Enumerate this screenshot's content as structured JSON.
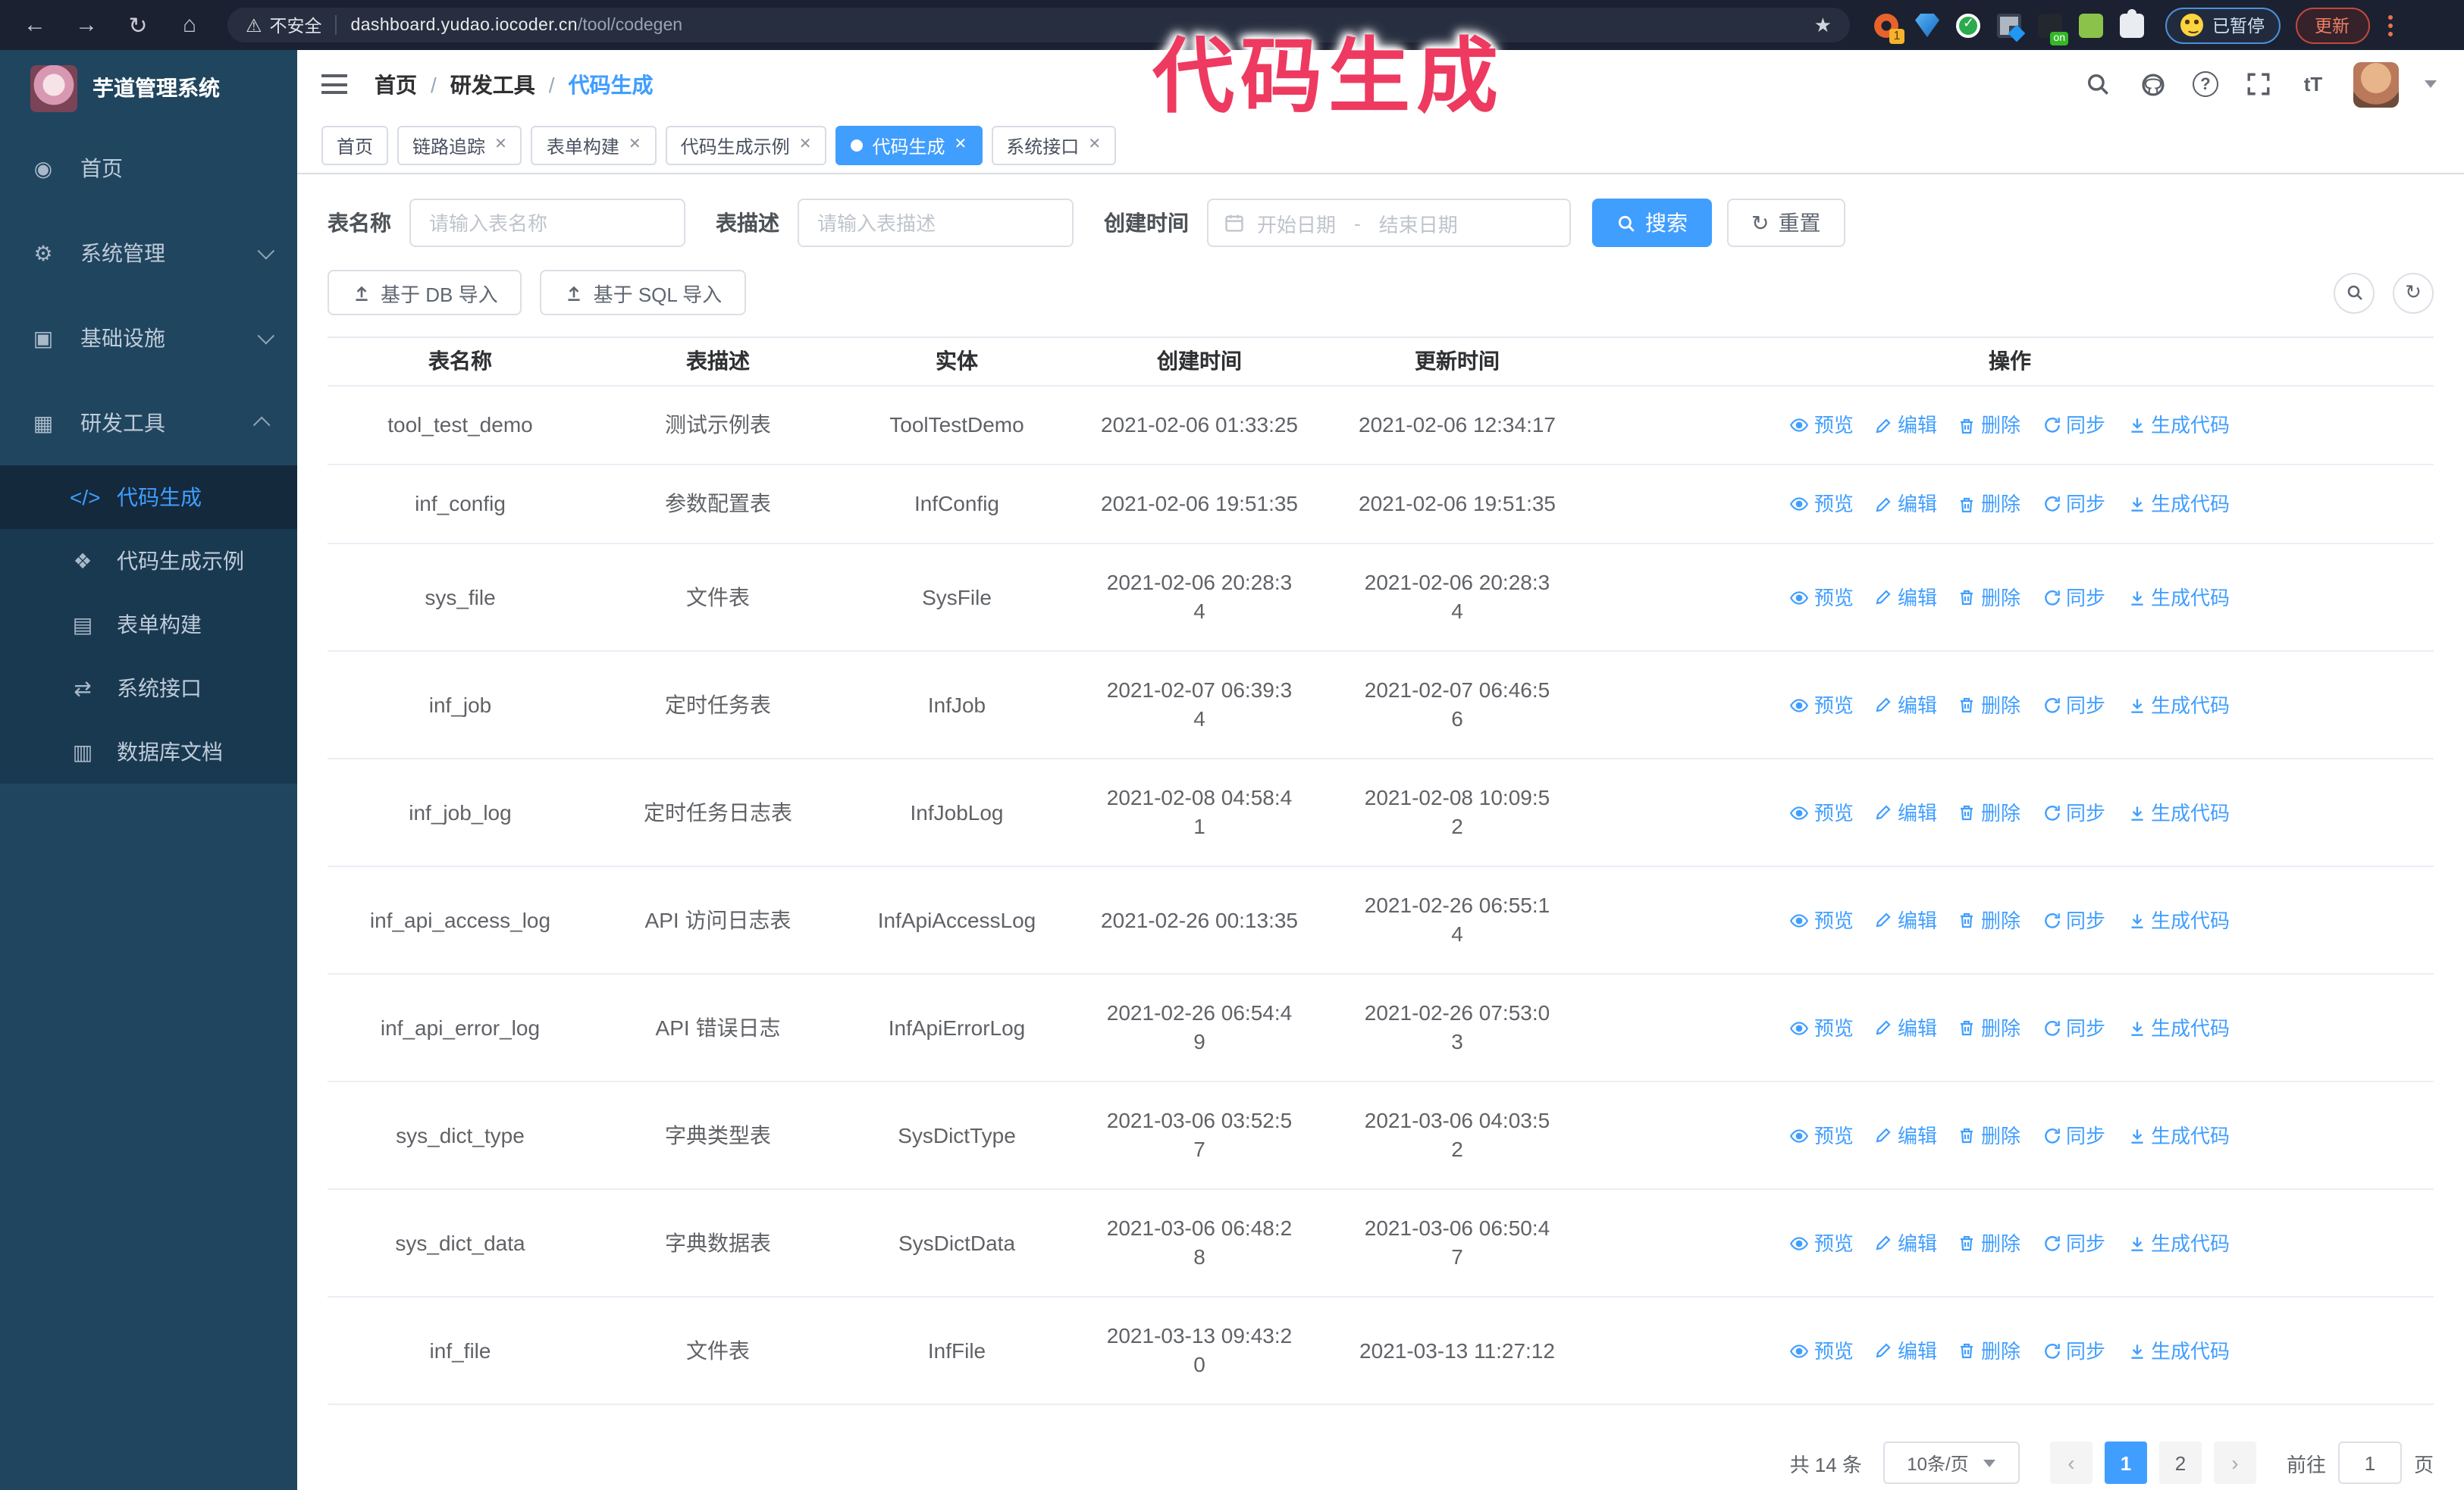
{
  "overlay": {
    "caption": "代码生成"
  },
  "browser": {
    "insecure_label": "不安全",
    "url_host": "dashboard.yudao.iocoder.cn",
    "url_path": "/tool/codegen",
    "paused_badge": "已暂停",
    "update_button": "更新"
  },
  "sidebar": {
    "app_title": "芋道管理系统",
    "items": [
      {
        "label": "首页"
      },
      {
        "label": "系统管理"
      },
      {
        "label": "基础设施"
      },
      {
        "label": "研发工具"
      }
    ],
    "submenu": [
      {
        "label": "代码生成"
      },
      {
        "label": "代码生成示例"
      },
      {
        "label": "表单构建"
      },
      {
        "label": "系统接口"
      },
      {
        "label": "数据库文档"
      }
    ]
  },
  "breadcrumb": {
    "items": [
      "首页",
      "研发工具",
      "代码生成"
    ]
  },
  "tabs": [
    {
      "label": "首页"
    },
    {
      "label": "链路追踪"
    },
    {
      "label": "表单构建"
    },
    {
      "label": "代码生成示例"
    },
    {
      "label": "代码生成"
    },
    {
      "label": "系统接口"
    }
  ],
  "filters": {
    "name_label": "表名称",
    "name_placeholder": "请输入表名称",
    "desc_label": "表描述",
    "desc_placeholder": "请输入表描述",
    "time_label": "创建时间",
    "start_placeholder": "开始日期",
    "range_separator": "-",
    "end_placeholder": "结束日期",
    "search_label": "搜索",
    "reset_label": "重置"
  },
  "toolbar": {
    "import_db": "基于 DB 导入",
    "import_sql": "基于 SQL 导入"
  },
  "table": {
    "columns": [
      "表名称",
      "表描述",
      "实体",
      "创建时间",
      "更新时间",
      "操作"
    ],
    "row_actions": [
      "预览",
      "编辑",
      "删除",
      "同步",
      "生成代码"
    ],
    "rows": [
      {
        "name": "tool_test_demo",
        "desc": "测试示例表",
        "entity": "ToolTestDemo",
        "created": "2021-02-06 01:33:25",
        "updated": "2021-02-06 12:34:17"
      },
      {
        "name": "inf_config",
        "desc": "参数配置表",
        "entity": "InfConfig",
        "created": "2021-02-06 19:51:35",
        "updated": "2021-02-06 19:51:35"
      },
      {
        "name": "sys_file",
        "desc": "文件表",
        "entity": "SysFile",
        "created": "2021-02-06 20:28:3\n4",
        "updated": "2021-02-06 20:28:3\n4"
      },
      {
        "name": "inf_job",
        "desc": "定时任务表",
        "entity": "InfJob",
        "created": "2021-02-07 06:39:3\n4",
        "updated": "2021-02-07 06:46:5\n6"
      },
      {
        "name": "inf_job_log",
        "desc": "定时任务日志表",
        "entity": "InfJobLog",
        "created": "2021-02-08 04:58:4\n1",
        "updated": "2021-02-08 10:09:5\n2"
      },
      {
        "name": "inf_api_access_log",
        "desc": "API 访问日志表",
        "entity": "InfApiAccessLog",
        "created": "2021-02-26 00:13:35",
        "updated": "2021-02-26 06:55:1\n4"
      },
      {
        "name": "inf_api_error_log",
        "desc": "API 错误日志",
        "entity": "InfApiErrorLog",
        "created": "2021-02-26 06:54:4\n9",
        "updated": "2021-02-26 07:53:0\n3"
      },
      {
        "name": "sys_dict_type",
        "desc": "字典类型表",
        "entity": "SysDictType",
        "created": "2021-03-06 03:52:5\n7",
        "updated": "2021-03-06 04:03:5\n2"
      },
      {
        "name": "sys_dict_data",
        "desc": "字典数据表",
        "entity": "SysDictData",
        "created": "2021-03-06 06:48:2\n8",
        "updated": "2021-03-06 06:50:4\n7"
      },
      {
        "name": "inf_file",
        "desc": "文件表",
        "entity": "InfFile",
        "created": "2021-03-13 09:43:2\n0",
        "updated": "2021-03-13 11:27:12"
      }
    ]
  },
  "pagination": {
    "total": "共 14 条",
    "page_size": "10条/页",
    "pages": [
      "1",
      "2"
    ],
    "active_page": "1",
    "goto_label": "前往",
    "goto_value": "1",
    "goto_suffix": "页"
  },
  "colors": {
    "accent": "#409eff",
    "sidebar_bg": "#20455f",
    "submenu_bg": "#193950",
    "chrome_bg": "#1b2130",
    "caption": "#ee3a60",
    "tag_active": "#409eff"
  }
}
